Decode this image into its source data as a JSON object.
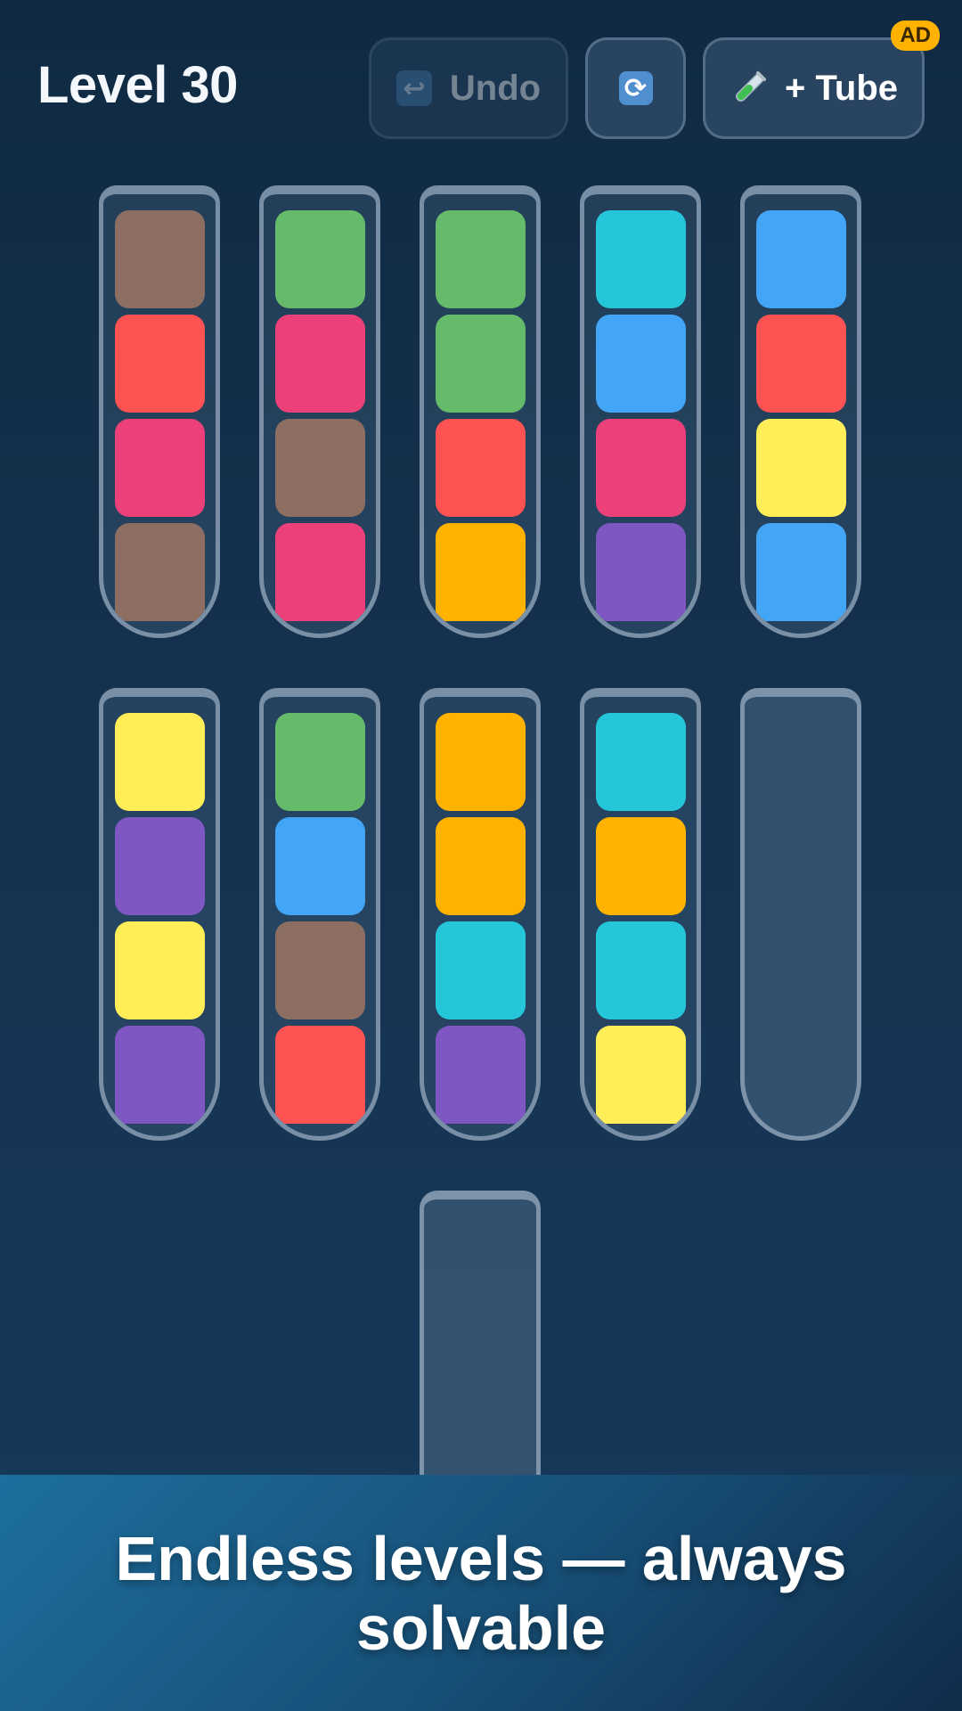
{
  "header": {
    "level_title": "Level 30",
    "undo_label": "Undo",
    "add_tube_label": "+ Tube",
    "ad_badge": "AD",
    "undo_icon": "undo-arrow-icon",
    "shuffle_icon": "shuffle-icon",
    "tube_icon": "test-tube-icon"
  },
  "colors": {
    "brown": "#8d6e63",
    "red": "#ff5252",
    "pink": "#ec407a",
    "green": "#66bb6a",
    "orange": "#ffb300",
    "cyan": "#26c6da",
    "blue": "#42a5f5",
    "purple": "#7e57c2",
    "yellow": "#ffee58"
  },
  "tubes": [
    [
      "brown",
      "red",
      "pink",
      "brown"
    ],
    [
      "green",
      "pink",
      "brown",
      "pink"
    ],
    [
      "green",
      "green",
      "red",
      "orange"
    ],
    [
      "cyan",
      "blue",
      "pink",
      "purple"
    ],
    [
      "blue",
      "red",
      "yellow",
      "blue"
    ],
    [
      "yellow",
      "purple",
      "yellow",
      "purple"
    ],
    [
      "green",
      "blue",
      "brown",
      "red"
    ],
    [
      "orange",
      "orange",
      "cyan",
      "purple"
    ],
    [
      "cyan",
      "orange",
      "cyan",
      "yellow"
    ],
    [],
    []
  ],
  "banner": {
    "text": "Endless levels — always solvable"
  }
}
